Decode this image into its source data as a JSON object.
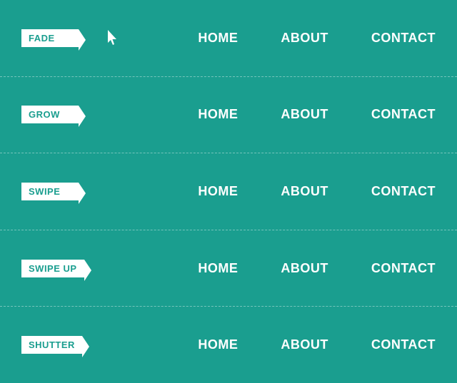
{
  "rows": [
    {
      "id": "fade-row",
      "label": "FADE",
      "show_cursor": true,
      "links": [
        {
          "id": "home-1",
          "text": "HOME"
        },
        {
          "id": "about-1",
          "text": "ABOUT"
        },
        {
          "id": "contact-1",
          "text": "CONTACT"
        }
      ]
    },
    {
      "id": "grow-row",
      "label": "GROW",
      "show_cursor": false,
      "links": [
        {
          "id": "home-2",
          "text": "HOME"
        },
        {
          "id": "about-2",
          "text": "ABOUT"
        },
        {
          "id": "contact-2",
          "text": "CONTACT"
        }
      ]
    },
    {
      "id": "swipe-row",
      "label": "SWIPE",
      "show_cursor": false,
      "links": [
        {
          "id": "home-3",
          "text": "HOME"
        },
        {
          "id": "about-3",
          "text": "ABOUT"
        },
        {
          "id": "contact-3",
          "text": "CONTACT"
        }
      ]
    },
    {
      "id": "swipe-up-row",
      "label": "SWIPE UP",
      "show_cursor": false,
      "links": [
        {
          "id": "home-4",
          "text": "HOME"
        },
        {
          "id": "about-4",
          "text": "ABOUT"
        },
        {
          "id": "contact-4",
          "text": "CONTACT"
        }
      ]
    },
    {
      "id": "shutter-row",
      "label": "SHUTTER",
      "show_cursor": false,
      "links": [
        {
          "id": "home-5",
          "text": "HOME"
        },
        {
          "id": "about-5",
          "text": "ABOUT"
        },
        {
          "id": "contact-5",
          "text": "CONTACT"
        }
      ]
    }
  ]
}
